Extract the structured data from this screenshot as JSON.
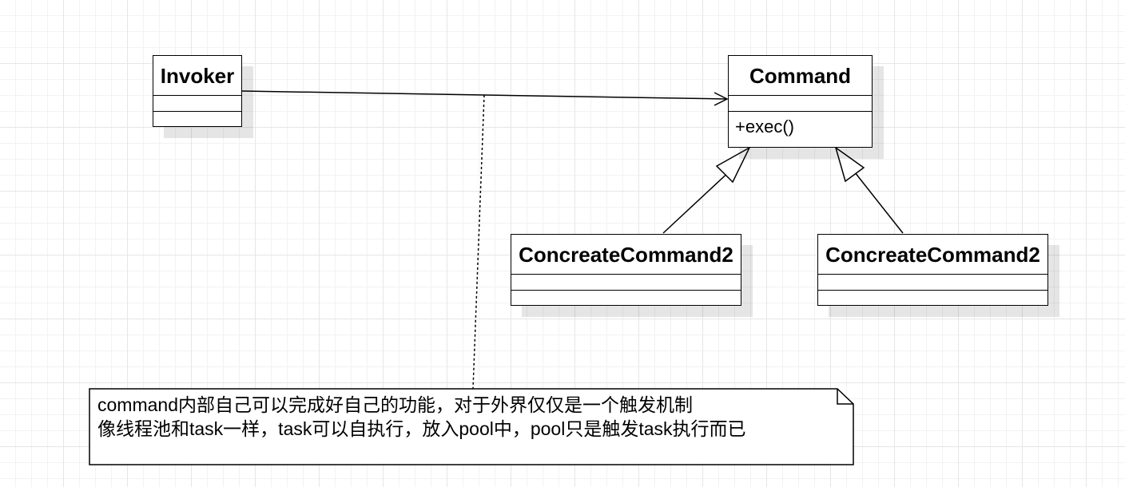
{
  "classes": {
    "invoker": {
      "name": "Invoker"
    },
    "command": {
      "name": "Command",
      "operation": "+exec()"
    },
    "concrete_left": {
      "name": "ConcreateCommand2"
    },
    "concrete_right": {
      "name": "ConcreateCommand2"
    }
  },
  "note": {
    "lines": [
      "command内部自己可以完成好自己的功能，对于外界仅仅是一个触发机制",
      "像线程池和task一样，task可以自执行，放入pool中，pool只是触发task执行而已"
    ]
  },
  "relations": [
    {
      "type": "association",
      "from": "Invoker",
      "to": "Command"
    },
    {
      "type": "generalization",
      "from": "ConcreateCommand2 (left)",
      "to": "Command"
    },
    {
      "type": "generalization",
      "from": "ConcreateCommand2 (right)",
      "to": "Command"
    },
    {
      "type": "note-anchor",
      "from": "note",
      "to": "Invoker-Command association"
    }
  ]
}
